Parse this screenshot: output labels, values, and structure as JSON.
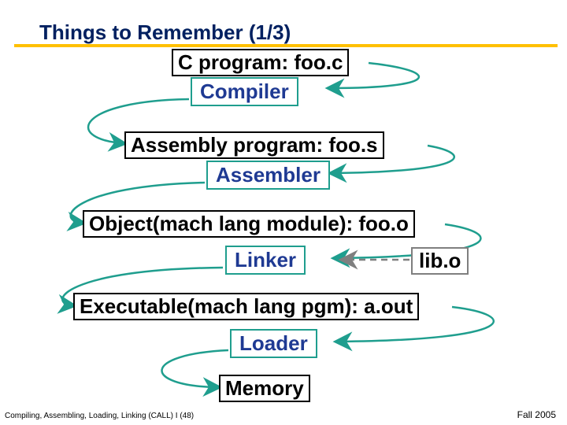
{
  "title": "Things to Remember (1/3)",
  "boxes": {
    "cprogram": "C program: foo.c",
    "asmprogram": "Assembly program: foo.s",
    "object": "Object(mach lang module): foo.o",
    "executable": "Executable(mach lang pgm): a.out",
    "memory": "Memory"
  },
  "stages": {
    "compiler": "Compiler",
    "assembler": "Assembler",
    "linker": "Linker",
    "loader": "Loader"
  },
  "lib": "lib.o",
  "footer_left": "Compiling, Assembling, Loading, Linking (CALL) I (48)",
  "footer_right": "Fall 2005",
  "colors": {
    "title": "#002060",
    "underline": "#ffc000",
    "stage_border": "#1f9e8e",
    "stage_text": "#1f3a93",
    "arrow": "#1f9e8e",
    "lib_border": "#7f7f7f"
  }
}
